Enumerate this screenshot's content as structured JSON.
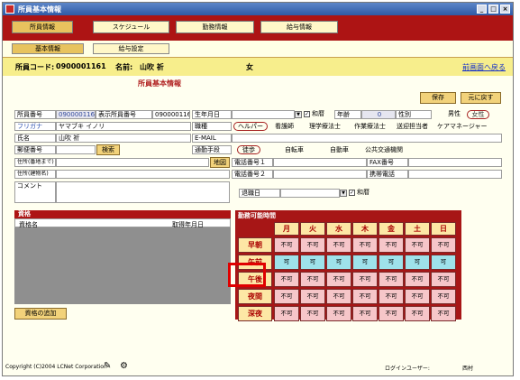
{
  "window": {
    "title": "所員基本情報",
    "min": "_",
    "max": "□",
    "close": "×"
  },
  "main_tabs": [
    "所員情報",
    "スケジュール",
    "勤務情報",
    "給与情報"
  ],
  "sub_tabs": [
    "基本情報",
    "給与設定"
  ],
  "employee": {
    "code_label": "所員コード:",
    "code": "0900001161",
    "name_label": "名前:",
    "name": "山吹 祈",
    "gender": "女",
    "back_link": "前画面へ戻る"
  },
  "section_title": "所員基本情報",
  "buttons": {
    "save": "保存",
    "revert": "元に戻す",
    "zip_search": "検索",
    "map": "地図",
    "add_qualification": "資格の追加"
  },
  "form": {
    "staff_no_label": "所員番号",
    "staff_no": "0900001161",
    "display_no_label": "表示所員番号",
    "display_no": "0900001161",
    "birthday_label": "生年月日",
    "birthday": "",
    "wareki_label": "和暦",
    "age_label": "年齢",
    "age": "0",
    "sex_label": "性別",
    "male_label": "男性",
    "female_label": "女性",
    "furigana_label": "フリガナ",
    "furigana": "ヤマブキ イノリ",
    "job_label": "職種",
    "jobs": [
      "ヘルパー",
      "看護師",
      "理学療法士",
      "作業療法士",
      "送迎担当者",
      "ケアマネージャー"
    ],
    "name_label": "氏名",
    "name": "山吹 祈",
    "email_label": "E-MAIL",
    "email": "",
    "zip_label": "郵便番号",
    "zip": "",
    "commute_label": "通勤手段",
    "commutes": [
      "徒歩",
      "自転車",
      "自動車",
      "公共交通機関"
    ],
    "address_label": "住所(番地まで)",
    "address": "",
    "building_label": "住所(建物名)",
    "building": "",
    "phone1_label": "電話番号１",
    "phone1": "",
    "fax_label": "FAX番号",
    "fax": "",
    "phone2_label": "電話番号２",
    "phone2": "",
    "mobile_label": "携帯電話",
    "mobile": "",
    "comment_label": "コメント",
    "comment": "",
    "retire_label": "退職日",
    "retire": "",
    "wareki2_label": "和暦",
    "checkmark": "✓",
    "dropdown_arrow": "▼"
  },
  "qualifications": {
    "header": "資格",
    "col_name": "資格名",
    "col_date": "取得年月日"
  },
  "availability": {
    "header": "勤務可能時間",
    "days": [
      "月",
      "火",
      "水",
      "木",
      "金",
      "土",
      "日"
    ],
    "rows": [
      {
        "slot": "早朝",
        "values": [
          "不可",
          "不可",
          "不可",
          "不可",
          "不可",
          "不可",
          "不可"
        ],
        "color": "pink"
      },
      {
        "slot": "午前",
        "values": [
          "可",
          "可",
          "可",
          "可",
          "可",
          "可",
          "可"
        ],
        "color": "cyan"
      },
      {
        "slot": "午後",
        "values": [
          "不可",
          "不可",
          "不可",
          "不可",
          "不可",
          "不可",
          "不可"
        ],
        "color": "pink"
      },
      {
        "slot": "夜間",
        "values": [
          "不可",
          "不可",
          "不可",
          "不可",
          "不可",
          "不可",
          "不可"
        ],
        "color": "pink"
      },
      {
        "slot": "深夜",
        "values": [
          "不可",
          "不可",
          "不可",
          "不可",
          "不可",
          "不可",
          "不可"
        ],
        "color": "pink"
      }
    ]
  },
  "footer": {
    "copyright": "Copyright (C)2004 LCNet Corporation",
    "login_label": "ログインユーザー:",
    "login_user": "西村"
  },
  "colors": {
    "titlebar": "#2f5aa6",
    "tabbar": "#ad1414",
    "highlight": "#e00000",
    "pink_cell": "#f6c6c9",
    "cyan_cell": "#9ee2ea"
  }
}
